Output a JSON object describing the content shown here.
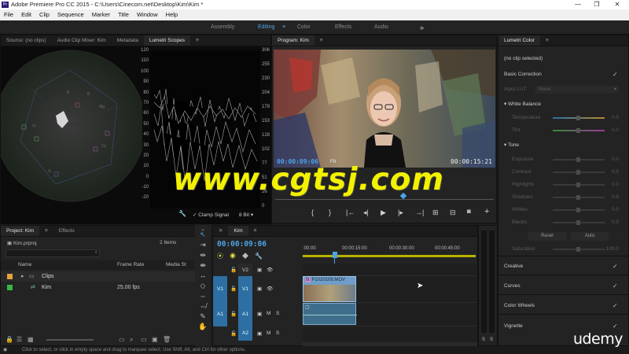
{
  "app": {
    "title": "Adobe Premiere Pro CC 2015 - C:\\Users\\Cinecom.net\\Desktop\\Kim\\Kim *",
    "logo": "Pr",
    "window_buttons": [
      "—",
      "❐",
      "✕"
    ]
  },
  "menu": [
    "File",
    "Edit",
    "Clip",
    "Sequence",
    "Marker",
    "Title",
    "Window",
    "Help"
  ],
  "workspaces": {
    "items": [
      "Assembly",
      "Editing",
      "Color",
      "Effects",
      "Audio"
    ],
    "active": "Editing",
    "more": "»"
  },
  "source_panel": {
    "tabs": [
      "Source: (no clips)",
      "Audio Clip Mixer: Kim",
      "Metadata",
      "Lumetri Scopes"
    ],
    "active_tab": "Lumetri Scopes",
    "vectorscope_labels": [
      "R",
      "Mg",
      "B",
      "Yl",
      "G",
      "Cy"
    ],
    "waveform_scale_left": [
      "120",
      "110",
      "100",
      "90",
      "80",
      "70",
      "60",
      "50",
      "40",
      "30",
      "20",
      "10",
      "0",
      "-10",
      "-20"
    ],
    "waveform_scale_right": [
      "306",
      "255",
      "230",
      "204",
      "179",
      "153",
      "128",
      "102",
      "77",
      "51",
      "26",
      "0"
    ],
    "clamp_signal_label": "Clamp Signal",
    "bit_depth": "8 Bit"
  },
  "program_panel": {
    "title": "Program: Kim",
    "timecode_current": "00:00:09:06",
    "timecode_duration": "00:00:15:21",
    "fit_label": "Fit",
    "transport_icons": [
      "{",
      "}",
      "|←",
      "◂|",
      "▶",
      "|▸",
      "→|",
      "⊞",
      "⊟",
      "📷"
    ],
    "add_icon": "+"
  },
  "lumetri_color": {
    "title": "Lumetri Color",
    "status": "(no clip selected)",
    "basic_correction": "Basic Correction",
    "input_lut_label": "Input LUT",
    "input_lut_value": "None",
    "white_balance": "White Balance",
    "wb_sliders": [
      {
        "label": "Temperature",
        "value": "0.0"
      },
      {
        "label": "Tint",
        "value": "0.0"
      }
    ],
    "tone": "Tone",
    "tone_sliders": [
      {
        "label": "Exposure",
        "value": "0.0"
      },
      {
        "label": "Contrast",
        "value": "0.0"
      },
      {
        "label": "Highlights",
        "value": "0.0"
      },
      {
        "label": "Shadows",
        "value": "0.0"
      },
      {
        "label": "Whites",
        "value": "0.0"
      },
      {
        "label": "Blacks",
        "value": "0.0"
      }
    ],
    "reset_label": "Reset",
    "auto_label": "Auto",
    "saturation_label": "Saturation",
    "saturation_value": "100.0",
    "sections": [
      "Creative",
      "Curves",
      "Color Wheels",
      "Vignette"
    ]
  },
  "project_panel": {
    "tabs": [
      "Project: Kim",
      "Effects"
    ],
    "file": "Kim.prproj",
    "item_count": "2 Items",
    "columns": [
      "Name",
      "Frame Rate",
      "Media St"
    ],
    "rows": [
      {
        "name": "Clips",
        "frame_rate": "",
        "color": "#e8a33a",
        "type": "bin"
      },
      {
        "name": "Kim",
        "frame_rate": "25,00 fps",
        "color": "#39b54a",
        "type": "sequence"
      }
    ]
  },
  "timeline": {
    "tab": "Kim",
    "timecode": "00:00:09:06",
    "ruler": [
      ":00:00",
      "00:00:15:00",
      "00:00:30:00",
      "00:00:45:00"
    ],
    "tracks": [
      {
        "id": "V2",
        "kind": "video"
      },
      {
        "id": "V1",
        "kind": "video",
        "source": "V1"
      },
      {
        "id": "A1",
        "kind": "audio",
        "source": "A1",
        "m": "M",
        "s": "S"
      },
      {
        "id": "A2",
        "kind": "audio",
        "m": "M",
        "s": "S"
      }
    ],
    "clip_name": "P1020109.MOV",
    "clip_fx": "fx"
  },
  "meters": {
    "labels": [
      "S",
      "S"
    ]
  },
  "status_bar": "Click to select, or click in empty space and drag to marquee select. Use Shift, Alt, and Ctrl for other options.",
  "overlay_watermark": "www.cgtsj.com",
  "udemy_logo": "udemy",
  "colors": {
    "accent": "#4da3e6",
    "watermark": "#f2f200",
    "track_blue": "#2e6fa3"
  }
}
